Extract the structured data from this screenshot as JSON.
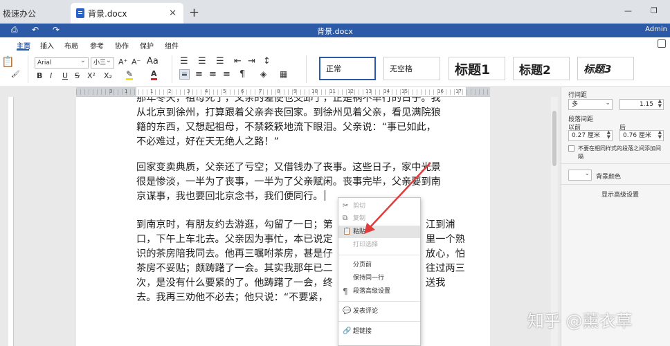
{
  "tabs": {
    "inactive_label": "极速办公",
    "active_label": "背景.docx",
    "close_glyph": "✕",
    "add_glyph": "+"
  },
  "window": {
    "minimize": "—",
    "restore": "❐"
  },
  "titlebar": {
    "title": "背景.docx",
    "user": "Admin"
  },
  "menu": {
    "items": [
      "主页",
      "插入",
      "布局",
      "参考",
      "协作",
      "保护",
      "组件"
    ]
  },
  "ribbon": {
    "font_name": "Arial",
    "font_size": "小三",
    "bold": "B",
    "italic": "I",
    "underline": "U",
    "strike": "S",
    "superscript": "X²",
    "subscript": "X₂",
    "grow_font": "A⁺",
    "shrink_font": "A⁻",
    "font_color": "A",
    "styles": [
      "正常",
      "无空格",
      "标题1",
      "标题2",
      "标题3"
    ]
  },
  "ruler": {
    "labels": [
      "3",
      "1",
      "1",
      "2",
      "3",
      "4",
      "5",
      "6",
      "7",
      "8",
      "9",
      "10",
      "11",
      "12",
      "13",
      "14",
      "15",
      "16",
      "17"
    ]
  },
  "document": {
    "paragraph_1": [
      "那年冬天，祖母死了，父亲的差使也交卸了，正是祸不单行的日子。我",
      "从北京到徐州，打算跟着父亲奔丧回家。到徐州见着父亲，看见满院狼",
      "籍的东西，又想起祖母，不禁簌簌地流下眼泪。父亲说：“事已如此，",
      "不必难过，好在天无绝人之路！”"
    ],
    "paragraph_2": [
      "回家变卖典质，父亲还了亏空；又借钱办了丧事。这些日子，家中光景",
      "很是惨淡，一半为了丧事，一半为了父亲赋闲。丧事完毕，父亲要到南",
      "京谋事，我也要回北京念书，我们便同行。"
    ],
    "paragraph_3": [
      "到南京时，有朋友约去游逛，勾留了一日；第",
      "口，下午上车北去。父亲因为事忙，本已说定",
      "识的茶房陪我同去。他再三嘱咐茶房，甚是仔",
      "茶房不妥贴；颇踌躇了一会。其实我那年已二",
      "次，是没有什么要紧的了。他踌躇了一会，终",
      "去。我再三劝他不必去；他只说：“不要紧，"
    ],
    "paragraph_3_right": [
      "江到浦",
      "里一个熟",
      "放心，怕",
      "往过两三",
      "送我",
      ""
    ]
  },
  "context_menu": {
    "items": [
      {
        "label": "剪切",
        "icon": "✂",
        "icon_name": "scissors-icon",
        "disabled": true
      },
      {
        "label": "复制",
        "icon": "⧉",
        "icon_name": "copy-icon",
        "disabled": true
      },
      {
        "label": "粘贴",
        "icon": "📋",
        "icon_name": "paste-icon",
        "disabled": false,
        "hover": true
      },
      {
        "label": "打印选择",
        "icon": "",
        "icon_name": "",
        "disabled": true
      },
      {
        "label": "分页前",
        "icon": "",
        "icon_name": "",
        "disabled": false
      },
      {
        "label": "保持同一行",
        "icon": "",
        "icon_name": "",
        "disabled": false
      },
      {
        "label": "段落高级设置",
        "icon": "¶",
        "icon_name": "paragraph-icon",
        "disabled": false
      },
      {
        "label": "发表评论",
        "icon": "💬",
        "icon_name": "comment-icon",
        "disabled": false
      },
      {
        "label": "超链接",
        "icon": "🔗",
        "icon_name": "link-icon",
        "disabled": false
      }
    ]
  },
  "right_panel": {
    "line_spacing_label": "行间距",
    "line_spacing_type": "多",
    "line_spacing_value": "1.15",
    "para_spacing_label": "段落间距",
    "before_label": "以前",
    "after_label": "后",
    "before_value": "0.27 厘米",
    "after_value": "0.76 厘米",
    "no_space_checkbox_label_1": "不要在相同样式的段落之间添加间",
    "no_space_checkbox_label_2": "隔",
    "background_color_label": "背景颜色",
    "advanced_link": "显示高级设置"
  },
  "watermark": "知乎 @薰衣草",
  "colors": {
    "accent": "#2d5aa6",
    "arrow": "#e23b3b"
  }
}
